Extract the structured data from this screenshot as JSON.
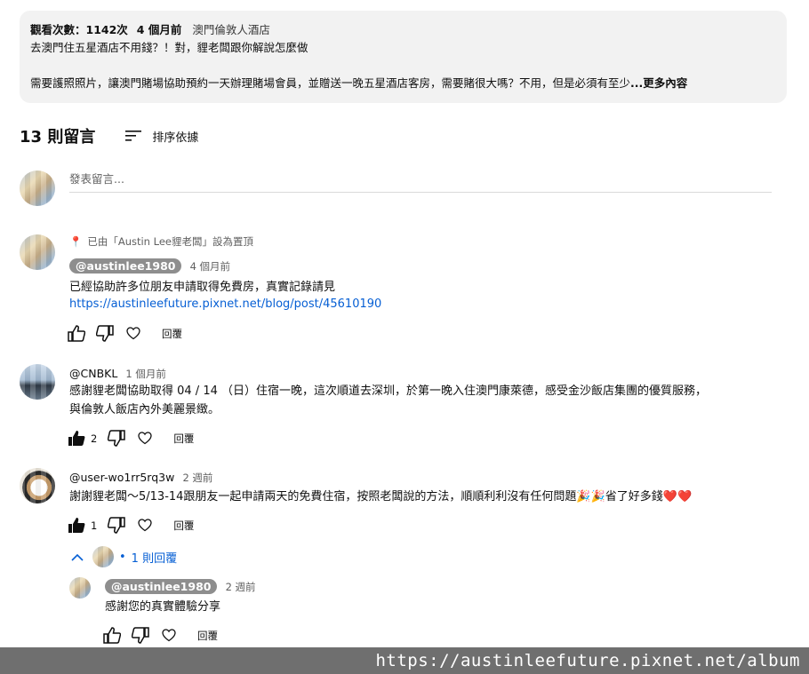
{
  "description": {
    "views": "觀看次數：1142次",
    "age": "4 個月前",
    "tag": "澳門倫敦人酒店",
    "line1": "去澳門住五星酒店不用錢？！對，貍老闆跟你解說怎麼做",
    "line2": "需要護照照片，讓澳門賭場協助預約一天辦理賭場會員，並贈送一晚五星酒店客房，需要賭很大嗎？不用，但是必須有至少",
    "more": "...更多內容"
  },
  "comments_header": {
    "count": "13 則留言",
    "sort_label": "排序依據"
  },
  "add_comment": {
    "placeholder": "發表留言..."
  },
  "comments": [
    {
      "pinned": "已由「Austin Lee貍老闆」設為置頂",
      "author": "@austinlee1980",
      "time": "4 個月前",
      "text": "已經協助許多位朋友申請取得免費房，真實記錄請見",
      "link": "https://austinleefuture.pixnet.net/blog/post/45610190",
      "likes": "",
      "reply_label": "回覆"
    },
    {
      "author": "@CNBKL",
      "time": "1 個月前",
      "text1": "感謝貍老闆協助取得 04 / 14 （日）住宿一晚，這次順道去深圳，於第一晚入住澳門康萊德，感受金沙飯店集團的優質服務，",
      "text2": "與倫敦人飯店內外美麗景緻。",
      "likes": "2",
      "reply_label": "回覆"
    },
    {
      "author": "@user-wo1rr5rq3w",
      "time": "2 週前",
      "text": "謝謝貍老闆～5/13-14跟朋友一起申請兩天的免費住宿，按照老闆說的方法，順順利利沒有任何問題🎉🎉省了好多錢❤️❤️",
      "likes": "1",
      "reply_label": "回覆",
      "replies_toggle": "1 則回覆"
    }
  ],
  "reply": {
    "author": "@austinlee1980",
    "time": "2 週前",
    "text": "感謝您的真實體驗分享",
    "reply_label": "回覆"
  },
  "watermark": "https://austinleefuture.pixnet.net/album"
}
